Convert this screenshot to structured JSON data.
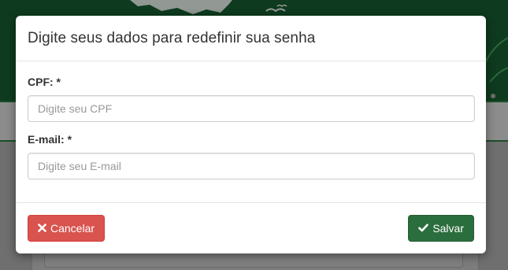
{
  "modal": {
    "title": "Digite seus dados para redefinir sua senha"
  },
  "form": {
    "cpf": {
      "label": "CPF: *",
      "placeholder": "Digite seu CPF",
      "value": ""
    },
    "email": {
      "label": "E-mail: *",
      "placeholder": "Digite seu E-mail",
      "value": ""
    }
  },
  "footer": {
    "cancel_label": "Cancelar",
    "cancel_icon": "close-icon",
    "save_label": "Salvar",
    "save_icon": "check-icon"
  },
  "colors": {
    "header_green": "#0e3b1f",
    "danger": "#d9534f",
    "success": "#2b6e3d"
  }
}
